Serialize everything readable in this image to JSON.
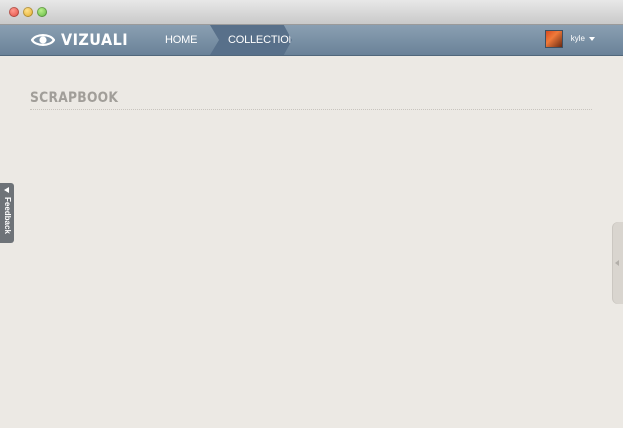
{
  "brand": {
    "name": "VIZUALI",
    "icon": "eye-icon"
  },
  "nav": {
    "items": [
      {
        "label": "HOME",
        "active": false
      },
      {
        "label": "COLLECTION",
        "active": true
      }
    ]
  },
  "user": {
    "name": "kyle",
    "avatar_icon": "avatar",
    "menu_icon": "caret-down-icon"
  },
  "page": {
    "title": "SCRAPBOOK"
  },
  "feedback": {
    "label": "Feedback",
    "icon": "arrow-left-icon"
  },
  "colors": {
    "navbar": "#7890a5",
    "active_tab": "#58708a",
    "page_background": "#ece9e4",
    "title_text": "#a19e99"
  }
}
